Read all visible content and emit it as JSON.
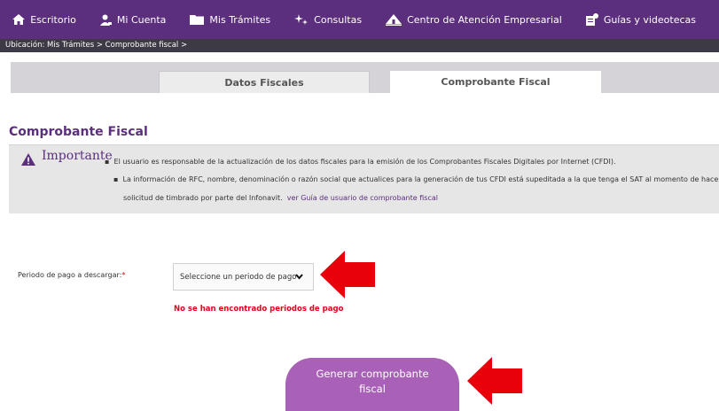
{
  "nav": {
    "items": [
      {
        "label": "Escritorio",
        "icon": "home-icon"
      },
      {
        "label": "Mi Cuenta",
        "icon": "user-icon"
      },
      {
        "label": "Mis Trámites",
        "icon": "folder-icon"
      },
      {
        "label": "Consultas",
        "icon": "sparkle-icon"
      },
      {
        "label": "Centro de Atención Empresarial",
        "icon": "building-icon"
      },
      {
        "label": "Guías y videotecas",
        "icon": "guide-icon"
      }
    ]
  },
  "breadcrumb": "Ubicación: Mis Trámites > Comprobante fiscal >",
  "tabs": {
    "datos_fiscales": "Datos Fiscales",
    "comprobante_fiscal": "Comprobante Fiscal"
  },
  "section_title": "Comprobante Fiscal",
  "notice": {
    "heading": "Importante",
    "line1": "El usuario es responsable de la actualización de los datos fiscales para la emisión de los Comprobantes Fiscales Digitales por Internet (CFDI).",
    "line2": "La información de RFC, nombre, denominación o razón social que actualices para la generación de tus CFDI está supeditada a la que tenga el SAT al momento de hacer la",
    "line3": "solicitud de timbrado por parte del Infonavit.",
    "link": "ver Guía de usuario de comprobante fiscal"
  },
  "period": {
    "label": "Periodo de pago a descargar:",
    "required_mark": "*",
    "selected": "Seleccione un periodo de pago",
    "error": "No se han encontrado periodos de pago"
  },
  "generate_button": {
    "line1": "Generar comprobante",
    "line2": "fiscal"
  },
  "colors": {
    "nav_bg": "#5c2e7e",
    "accent": "#a861b7",
    "error": "#e3001b",
    "arrow": "#e8000b"
  }
}
